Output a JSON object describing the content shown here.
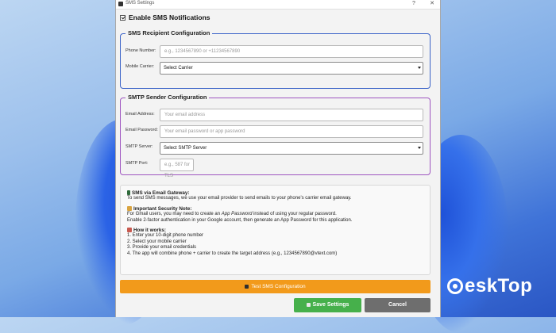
{
  "window": {
    "title": "SMS Settings",
    "help_glyph": "?",
    "close_glyph": "✕"
  },
  "enable": {
    "label": "Enable SMS Notifications",
    "checked": true
  },
  "recipient": {
    "title": "SMS Recipient Configuration",
    "phone_label": "Phone Number:",
    "phone_placeholder": "e.g., 1234567890 or +11234567890",
    "carrier_label": "Mobile Carrier:",
    "carrier_value": "Select Carrier"
  },
  "smtp": {
    "title": "SMTP Sender Configuration",
    "email_label": "Email Address:",
    "email_placeholder": "Your email address",
    "password_label": "Email Password:",
    "password_placeholder": "Your email password or app password",
    "server_label": "SMTP Server:",
    "server_value": "Select SMTP Server",
    "port_label": "SMTP Port:",
    "port_placeholder": "e.g., 587 for TLS"
  },
  "info": {
    "gateway_heading": "SMS via Email Gateway:",
    "gateway_text": "To send SMS messages, we use your email provider to send emails to your phone's carrier email gateway.",
    "security_heading": "Important Security Note:",
    "security_line1_pre": "For Gmail users, you may need to create an ",
    "security_line1_em": "App Password",
    "security_line1_post": " instead of using your regular password.",
    "security_line2": "Enable 2-factor authentication in your Google account, then generate an App Password for this application.",
    "how_heading": "How it works:",
    "steps": [
      "1. Enter your 10-digit phone number",
      "2. Select your mobile carrier",
      "3. Provide your email credentials",
      "4. The app will combine phone + carrier to create the target address (e.g., 1234567890@vtext.com)"
    ]
  },
  "buttons": {
    "test": "Test SMS Configuration",
    "save": "Save Settings",
    "cancel": "Cancel"
  },
  "watermark": {
    "text": "eskTop"
  },
  "colors": {
    "recipient_border": "#3b63c8",
    "smtp_border": "#9e55c0",
    "test_button": "#f29a1b",
    "save_button": "#46b04b",
    "cancel_button": "#6e6e6e"
  }
}
